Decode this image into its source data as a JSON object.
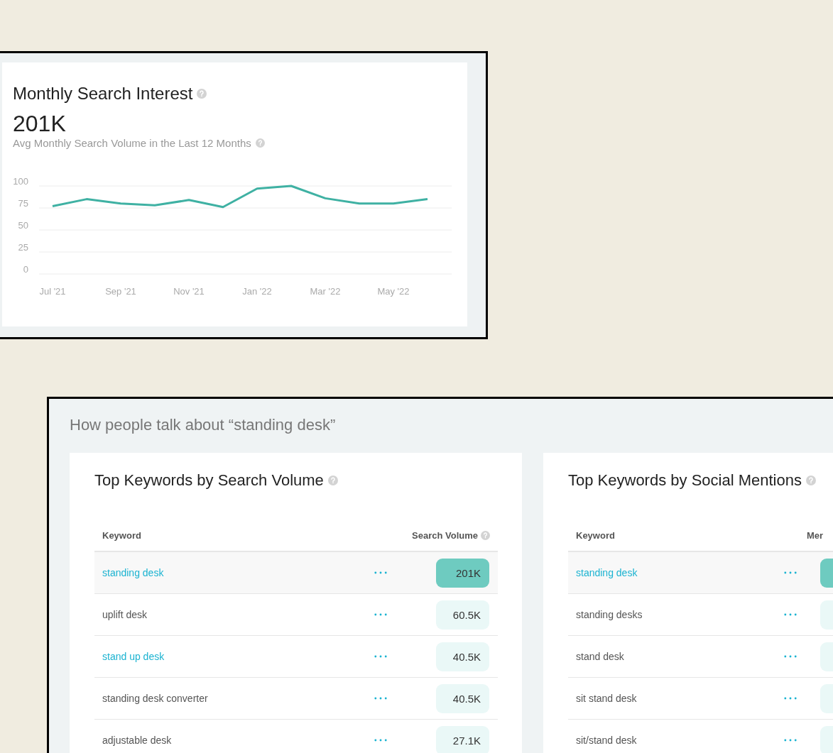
{
  "interest_card": {
    "title": "Monthly Search Interest",
    "value": "201K",
    "subtitle": "Avg Monthly Search Volume in the Last 12 Months",
    "chart_data": {
      "type": "line",
      "categories": [
        "Jul '21",
        null,
        "Sep '21",
        null,
        "Nov '21",
        null,
        "Jan '22",
        null,
        "Mar '22",
        null,
        "May '22",
        null
      ],
      "series": [
        {
          "color": "#3fb1a3",
          "values": [
            77,
            85,
            80,
            78,
            84,
            76,
            97,
            100,
            86,
            80,
            80,
            85
          ]
        }
      ],
      "ylim": [
        0,
        100
      ],
      "yticks": [
        0,
        25,
        50,
        75,
        100
      ],
      "grid": true
    }
  },
  "talk_section": {
    "heading": "How people talk about “standing desk”",
    "cards": [
      {
        "title": "Top Keywords by Search Volume",
        "columns": [
          "Keyword",
          "Search Volume"
        ],
        "rows": [
          {
            "keyword": "standing desk",
            "linked": true,
            "selected": true,
            "value": "201K"
          },
          {
            "keyword": "uplift desk",
            "linked": false,
            "selected": false,
            "value": "60.5K"
          },
          {
            "keyword": "stand up desk",
            "linked": true,
            "selected": false,
            "value": "40.5K"
          },
          {
            "keyword": "standing desk converter",
            "linked": false,
            "selected": false,
            "value": "40.5K"
          },
          {
            "keyword": "adjustable desk",
            "linked": false,
            "selected": false,
            "value": "27.1K"
          }
        ]
      },
      {
        "title": "Top Keywords by Social Mentions",
        "columns": [
          "Keyword",
          "Mer"
        ],
        "rows": [
          {
            "keyword": "standing desk",
            "linked": true,
            "selected": true
          },
          {
            "keyword": "standing desks",
            "linked": false,
            "selected": false
          },
          {
            "keyword": "stand desk",
            "linked": false,
            "selected": false
          },
          {
            "keyword": "sit stand desk",
            "linked": false,
            "selected": false
          },
          {
            "keyword": "sit/stand desk",
            "linked": false,
            "selected": false
          }
        ]
      }
    ]
  }
}
